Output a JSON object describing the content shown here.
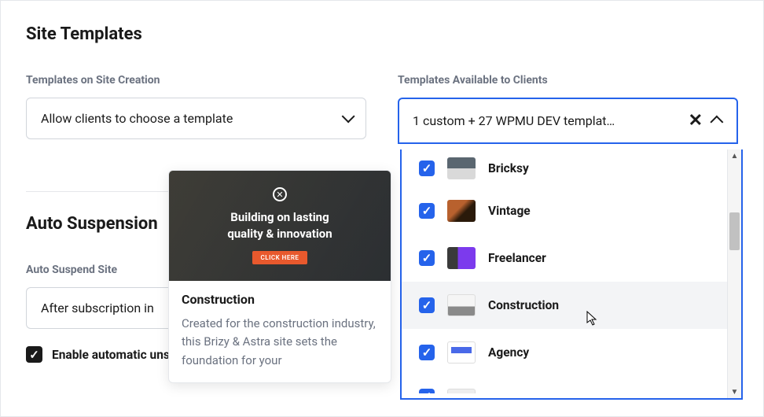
{
  "page": {
    "title": "Site Templates"
  },
  "templatesOnCreation": {
    "label": "Templates on Site Creation",
    "value": "Allow clients to choose a template"
  },
  "templatesAvailable": {
    "label": "Templates Available to Clients",
    "summary": "1 custom + 27 WPMU DEV templat…",
    "options": [
      {
        "name": "Bricksy",
        "checked": true
      },
      {
        "name": "Vintage",
        "checked": true
      },
      {
        "name": "Freelancer",
        "checked": true
      },
      {
        "name": "Construction",
        "checked": true,
        "highlight": true
      },
      {
        "name": "Agency",
        "checked": true
      }
    ]
  },
  "tooltip": {
    "heading_line1": "Building on lasting",
    "heading_line2": "quality & innovation",
    "cta": "CLICK HERE",
    "title": "Construction",
    "desc": "Created for the construction industry, this Brizy & Astra site sets the foundation for your"
  },
  "autoSuspension": {
    "title": "Auto Suspension",
    "suspendLabel": "Auto Suspend Site",
    "suspendValue": "After subscription in",
    "enableAuto": "Enable automatic unsuspension when the pending in"
  }
}
